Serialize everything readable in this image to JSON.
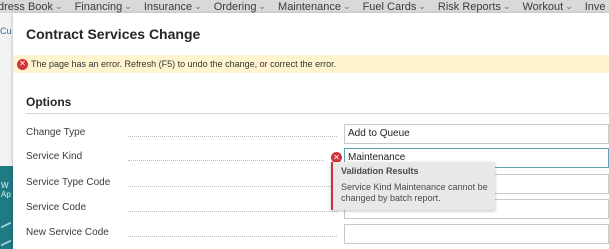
{
  "top_nav": {
    "items": [
      "dress Book",
      "Financing",
      "Insurance",
      "Ordering",
      "Maintenance",
      "Fuel Cards",
      "Risk Reports",
      "Workout",
      "Inve"
    ]
  },
  "background": {
    "left_tab": "Cu",
    "teal_text_1": "W",
    "teal_text_2": "Ap"
  },
  "dialog": {
    "title": "Contract Services Change",
    "error_banner": "The page has an error. Refresh (F5) to undo the change, or correct the error.",
    "section_title": "Options",
    "fields": [
      {
        "label": "Change Type",
        "value": "Add to Queue"
      },
      {
        "label": "Service Kind",
        "value": "Maintenance"
      },
      {
        "label": "Service Type Code",
        "value": ""
      },
      {
        "label": "Service Code",
        "value": ""
      },
      {
        "label": "New Service Code",
        "value": ""
      }
    ],
    "validation": {
      "title": "Validation Results",
      "message": "Service Kind Maintenance cannot be changed by batch report."
    }
  },
  "colors": {
    "error_red": "#d13438",
    "banner_bg": "#fff4ce",
    "teal_panel": "#1f7a84",
    "nav_bg": "#d9d9d9"
  },
  "icons": {
    "error": "error-circle-icon",
    "chevron": "chevron-down-icon"
  }
}
